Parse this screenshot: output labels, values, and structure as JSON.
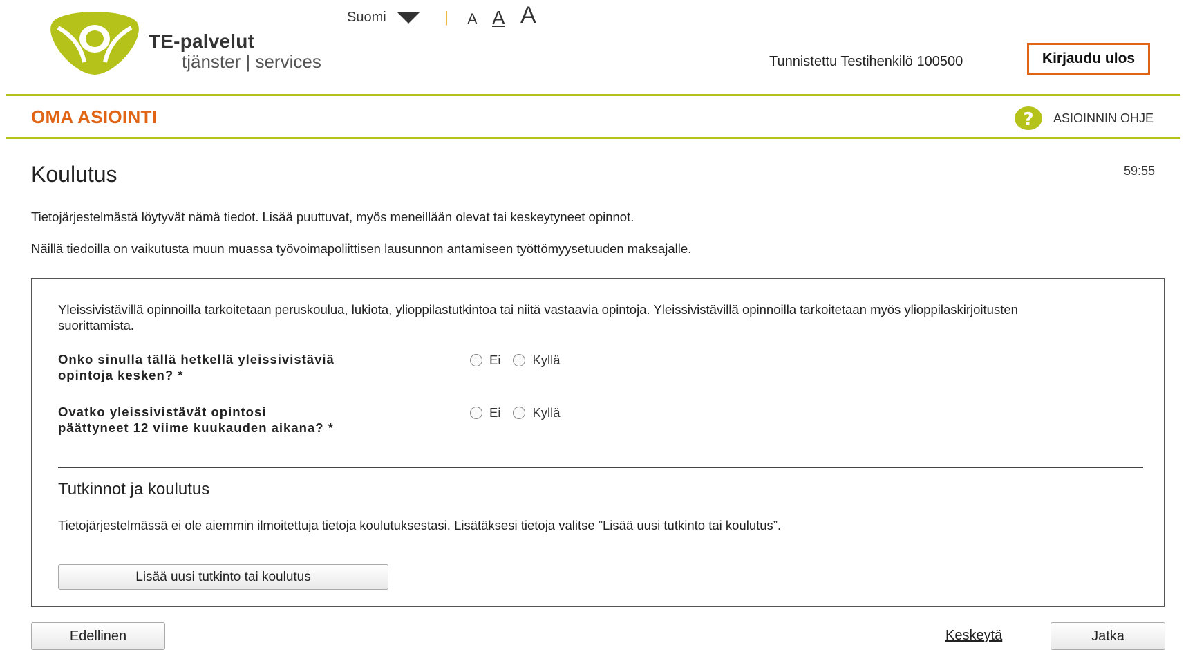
{
  "brand": {
    "name": "TE-palvelut",
    "subtitle": "tjänster | services",
    "logo_icon": "te-palvelut-logo-icon",
    "accent_color": "#b5c21a"
  },
  "header": {
    "language": "Suomi",
    "separator": "|",
    "font_sizes": [
      "A",
      "A",
      "A"
    ],
    "user_info": "Tunnistettu Testihenkilö 100500",
    "logout_label": "Kirjaudu ulos",
    "logout_border_color": "#e06414"
  },
  "nav": {
    "section_title": "OMA ASIOINTI",
    "help_label": "ASIOINNIN OHJE",
    "help_icon": "question-circle-icon"
  },
  "page": {
    "title": "Koulutus",
    "timer": "59:55",
    "intro_1": "Tietojärjestelmästä löytyvät nämä tiedot. Lisää puuttuvat, myös meneillään olevat tai keskeytyneet opinnot.",
    "intro_2": "Näillä tiedoilla on vaikutusta muun muassa työvoimapoliittisen lausunnon antamiseen työttömyysetuuden maksajalle."
  },
  "panel": {
    "intro": "Yleissivistävillä opinnoilla tarkoitetaan peruskoulua, lukiota, ylioppilastutkintoa tai niitä vastaavia opintoja. Yleissivistävillä opinnoilla tarkoitetaan myös ylioppilaskirjoitusten suorittamista.",
    "questions": [
      {
        "label": "Onko sinulla tällä hetkellä yleissivistäviä opintoja kesken? *",
        "options": [
          "Ei",
          "Kyllä"
        ]
      },
      {
        "label": "Ovatko yleissivistävät opintosi päättyneet 12 viime kuukauden aikana? *",
        "options": [
          "Ei",
          "Kyllä"
        ]
      }
    ],
    "section_title": "Tutkinnot ja koulutus",
    "section_text": "Tietojärjestelmässä ei ole aiemmin ilmoitettuja tietoja koulutuksestasi. Lisätäksesi tietoja valitse ”Lisää uusi tutkinto tai koulutus”.",
    "add_button": "Lisää uusi tutkinto tai koulutus"
  },
  "footer": {
    "previous": "Edellinen",
    "cancel": "Keskeytä",
    "next": "Jatka"
  }
}
